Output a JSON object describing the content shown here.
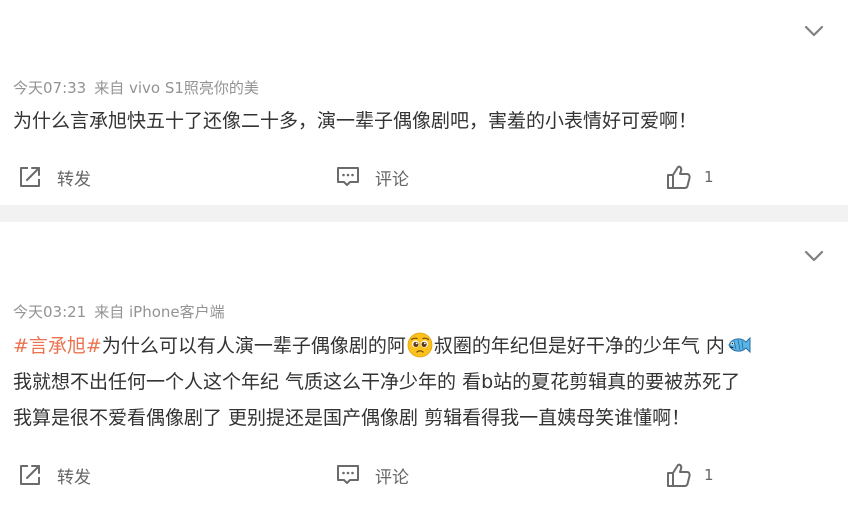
{
  "posts": [
    {
      "time": "今天07:33",
      "source": "来自 vivo S1照亮你的美",
      "text": "为什么言承旭快五十了还像二十多，演一辈子偶像剧吧，害羞的小表情好可爱啊！",
      "actions": {
        "repost": "转发",
        "comment": "评论",
        "like_count": "1"
      }
    },
    {
      "time": "今天03:21",
      "source": "来自 iPhone客户端",
      "hashtag": "#言承旭#",
      "text_part1": "为什么可以有人演一辈子偶像剧的阿",
      "text_part2": "叔圈的年纪但是好干净的少年气 内",
      "text_part3": "我就想不出任何一个人这个年纪 气质这么干净少年的 看b站的夏花剪辑真的要被苏死了",
      "text_part4": "我算是很不爱看偶像剧了 更别提还是国产偶像剧 剪辑看得我一直姨母笑谁懂啊！",
      "actions": {
        "repost": "转发",
        "comment": "评论",
        "like_count": "1"
      }
    }
  ],
  "icons": {
    "expand": "chevron-down-icon",
    "repost": "share-icon",
    "comment": "comment-icon",
    "like": "thumbs-up-icon",
    "emoji_1": "pleading-face-emoji",
    "emoji_2": "fish-emoji"
  },
  "colors": {
    "hashtag": "#eb7350",
    "meta": "#939393",
    "separator": "#f2f2f2"
  }
}
